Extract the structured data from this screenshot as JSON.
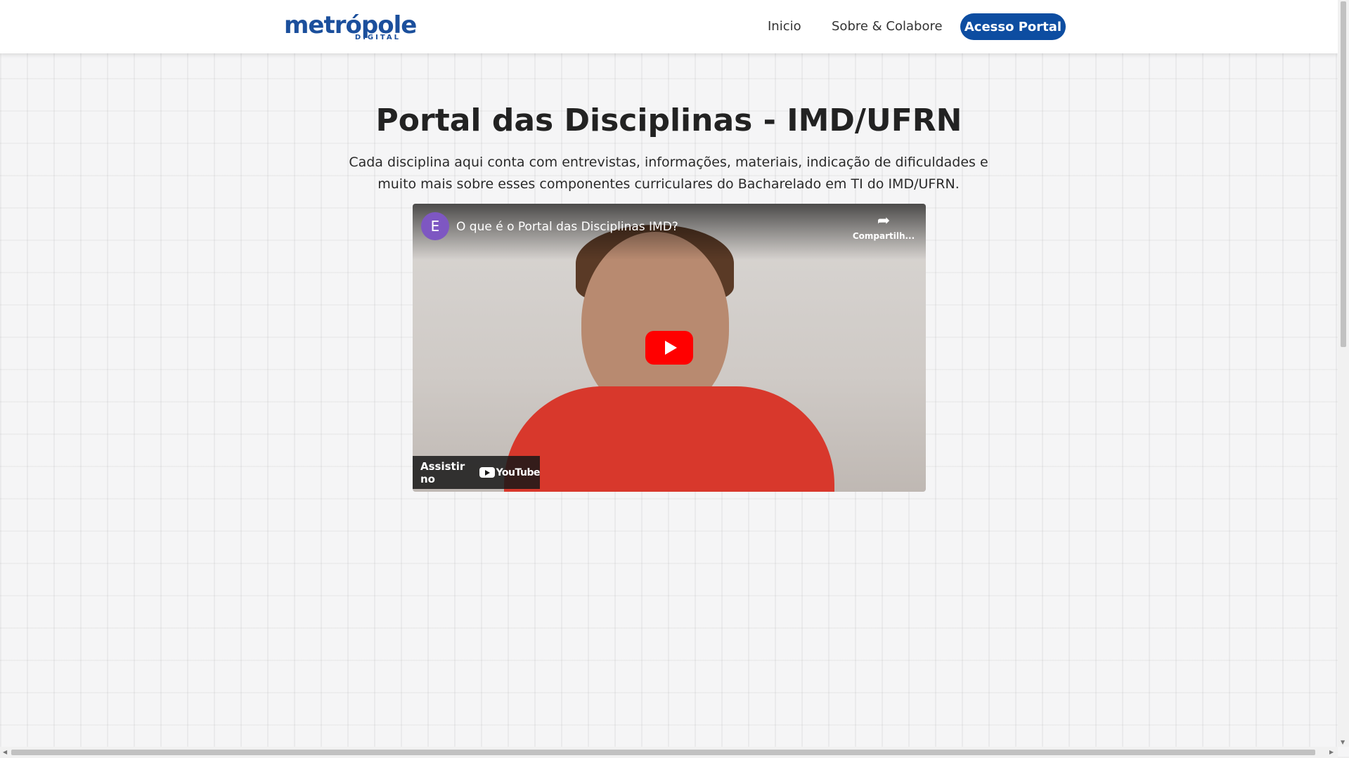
{
  "nav": {
    "logo_main": "metrópole",
    "logo_sub": "DIGITAL",
    "links": [
      "Inicio",
      "Sobre & Colabore"
    ],
    "cta": "Acesso Portal"
  },
  "hero": {
    "title": "Portal das Disciplinas - IMD/UFRN",
    "subtitle": "Cada disciplina aqui conta com entrevistas, informações, materiais, indicação de dificuldades e muito mais sobre esses componentes curriculares do Bacharelado em TI do IMD/UFRN."
  },
  "video": {
    "channel_initial": "E",
    "title": "O que é o Portal das Disciplinas IMD?",
    "share_label": "Compartilh...",
    "watch_on": "Assistir no",
    "platform": "YouTube"
  },
  "colors": {
    "brand": "#0d4da1",
    "youtube_red": "#ff0000",
    "avatar": "#7e57c2"
  }
}
